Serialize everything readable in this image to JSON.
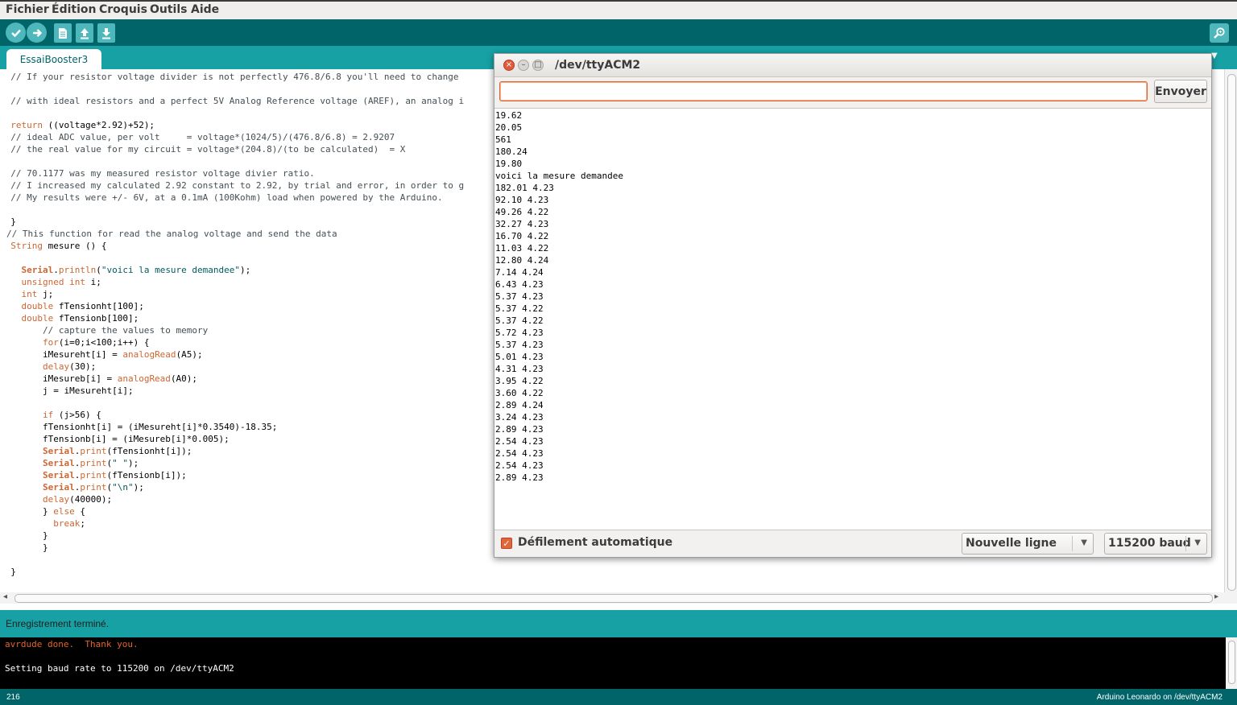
{
  "menu": [
    "Fichier",
    "Édition",
    "Croquis",
    "Outils",
    "Aide"
  ],
  "toolbar": {
    "icons": [
      "verify-icon",
      "upload-icon",
      "new-icon",
      "open-icon",
      "save-icon"
    ],
    "right_icon": "serial-monitor-icon"
  },
  "tabs": [
    {
      "label": "EssaiBooster3"
    }
  ],
  "editor": {
    "lines": [
      [
        [
          "cm",
          "  // If your resistor voltage divider is not perfectly 476.8/6.8 you'll need to change"
        ]
      ],
      [],
      [
        [
          "cm",
          "  // with ideal resistors and a perfect 5V Analog Reference voltage (AREF), an analog i"
        ]
      ],
      [],
      [
        [
          "kw",
          "  return"
        ],
        [
          "tx",
          " ((voltage*2.92)+52);"
        ]
      ],
      [
        [
          "cm",
          "  // ideal ADC value, per volt     = voltage*(1024/5)/(476.8/6.8) = 2.9207"
        ]
      ],
      [
        [
          "cm",
          "  // the real value for my circuit = voltage*(204.8)/(to be calculated)  = X"
        ]
      ],
      [],
      [
        [
          "cm",
          "  // 70.1177 was my measured resistor voltage divier ratio."
        ]
      ],
      [
        [
          "cm",
          "  // I increased my calculated 2.92 constant to 2.92, by trial and error, in order to g"
        ]
      ],
      [
        [
          "cm",
          "  // My results were +/- 6V, at a 0.1mA (100Kohm) load when powered by the Arduino."
        ]
      ],
      [],
      [
        [
          "tx",
          "  }"
        ]
      ],
      [
        [
          "cm",
          "// This function for read the analog voltage and send the data"
        ]
      ],
      [
        [
          "kw",
          "  String"
        ],
        [
          "tx",
          " mesure () {"
        ]
      ],
      [],
      [
        [
          "kb",
          "    Serial"
        ],
        [
          "tx",
          "."
        ],
        [
          "fn",
          "println"
        ],
        [
          "tx",
          "("
        ],
        [
          "st",
          "\"voici la mesure demandee\""
        ],
        [
          "tx",
          ");"
        ]
      ],
      [
        [
          "kw",
          "    unsigned int"
        ],
        [
          "tx",
          " i;"
        ]
      ],
      [
        [
          "kw",
          "    int"
        ],
        [
          "tx",
          " j;"
        ]
      ],
      [
        [
          "kw",
          "    double"
        ],
        [
          "tx",
          " fTensionht[100];"
        ]
      ],
      [
        [
          "kw",
          "    double"
        ],
        [
          "tx",
          " fTensionb[100];"
        ]
      ],
      [
        [
          "cm",
          "        // capture the values to memory"
        ]
      ],
      [
        [
          "kw",
          "        for"
        ],
        [
          "tx",
          "(i=0;i<100;i++) {"
        ]
      ],
      [
        [
          "tx",
          "        iMesureht[i] = "
        ],
        [
          "fn",
          "analogRead"
        ],
        [
          "tx",
          "(A5);"
        ]
      ],
      [
        [
          "fn",
          "        delay"
        ],
        [
          "tx",
          "(30);"
        ]
      ],
      [
        [
          "tx",
          "        iMesureb[i] = "
        ],
        [
          "fn",
          "analogRead"
        ],
        [
          "tx",
          "(A0);"
        ]
      ],
      [
        [
          "tx",
          "        j = iMesureht[i];"
        ]
      ],
      [],
      [
        [
          "kw",
          "        if"
        ],
        [
          "tx",
          " (j>56) {"
        ]
      ],
      [
        [
          "tx",
          "        fTensionht[i] = (iMesureht[i]*0.3540)-18.35;"
        ]
      ],
      [
        [
          "tx",
          "        fTensionb[i] = (iMesureb[i]*0.005);"
        ]
      ],
      [
        [
          "kb",
          "        Serial"
        ],
        [
          "tx",
          "."
        ],
        [
          "fn",
          "print"
        ],
        [
          "tx",
          "(fTensionht[i]);"
        ]
      ],
      [
        [
          "kb",
          "        Serial"
        ],
        [
          "tx",
          "."
        ],
        [
          "fn",
          "print"
        ],
        [
          "tx",
          "("
        ],
        [
          "st",
          "\" \""
        ],
        [
          "tx",
          ");"
        ]
      ],
      [
        [
          "kb",
          "        Serial"
        ],
        [
          "tx",
          "."
        ],
        [
          "fn",
          "print"
        ],
        [
          "tx",
          "(fTensionb[i]);"
        ]
      ],
      [
        [
          "kb",
          "        Serial"
        ],
        [
          "tx",
          "."
        ],
        [
          "fn",
          "print"
        ],
        [
          "tx",
          "("
        ],
        [
          "st",
          "\"\\n\""
        ],
        [
          "tx",
          ");"
        ]
      ],
      [
        [
          "fn",
          "        delay"
        ],
        [
          "tx",
          "(40000);"
        ]
      ],
      [
        [
          "tx",
          "        } "
        ],
        [
          "kw",
          "else"
        ],
        [
          "tx",
          " {"
        ]
      ],
      [
        [
          "kw",
          "          break"
        ],
        [
          "tx",
          ";"
        ]
      ],
      [
        [
          "tx",
          "        }"
        ]
      ],
      [
        [
          "tx",
          "        }"
        ]
      ],
      [],
      [
        [
          "tx",
          "  }"
        ]
      ]
    ]
  },
  "status": {
    "message": "Enregistrement terminé."
  },
  "console": {
    "lines": [
      {
        "text": "avrdude done.  Thank you.",
        "color": "#e0642e"
      },
      {
        "text": "",
        "color": "#ffffff"
      },
      {
        "text": "Setting baud rate to 115200 on /dev/ttyACM2",
        "color": "#ffffff"
      }
    ]
  },
  "footer": {
    "line": "216",
    "board": "Arduino Leonardo on /dev/ttyACM2"
  },
  "serial_monitor": {
    "title": "/dev/ttyACM2",
    "input_value": "",
    "send_label": "Envoyer",
    "output": [
      "19.62",
      "20.05",
      "561",
      "180.24",
      "19.80",
      "voici la mesure demandee",
      "182.01 4.23",
      "92.10 4.23",
      "49.26 4.22",
      "32.27 4.23",
      "16.70 4.22",
      "11.03 4.22",
      "12.80 4.24",
      "7.14 4.24",
      "6.43 4.23",
      "5.37 4.23",
      "5.37 4.22",
      "5.37 4.22",
      "5.72 4.23",
      "5.37 4.23",
      "5.01 4.23",
      "4.31 4.23",
      "3.95 4.22",
      "3.60 4.22",
      "2.89 4.24",
      "3.24 4.23",
      "2.89 4.23",
      "2.54 4.23",
      "2.54 4.23",
      "2.54 4.23",
      "2.89 4.23"
    ],
    "autoscroll_label": "Défilement automatique",
    "autoscroll_checked": true,
    "line_ending": "Nouvelle ligne",
    "baud": "115200 baud"
  },
  "colors": {
    "toolbar": "#006468",
    "tabstrip": "#17a1a5",
    "accent_orange": "#e0642e"
  }
}
